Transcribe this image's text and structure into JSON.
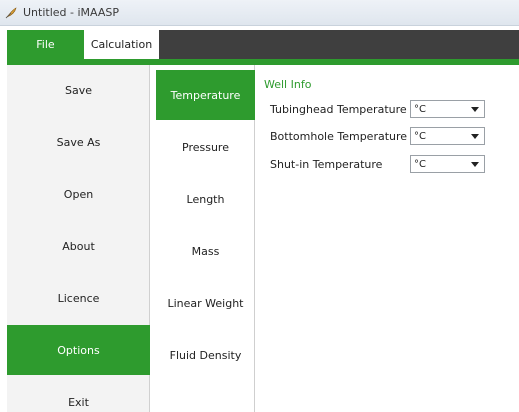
{
  "window": {
    "title": "Untitled - iMAASP",
    "app_icon": "feather-icon"
  },
  "menu": {
    "file_label": "File",
    "calculation_label": "Calculation"
  },
  "sidebar": {
    "items": [
      {
        "label": "Save"
      },
      {
        "label": "Save As"
      },
      {
        "label": "Open"
      },
      {
        "label": "About"
      },
      {
        "label": "Licence"
      },
      {
        "label": "Options",
        "active": true
      },
      {
        "label": "Exit"
      }
    ]
  },
  "subnav": {
    "items": [
      {
        "label": "Temperature",
        "active": true
      },
      {
        "label": "Pressure"
      },
      {
        "label": "Length"
      },
      {
        "label": "Mass"
      },
      {
        "label": "Linear Weight"
      },
      {
        "label": "Fluid Density"
      }
    ]
  },
  "panel": {
    "section_title": "Well Info",
    "fields": [
      {
        "label": "Tubinghead Temperature",
        "value": "°C"
      },
      {
        "label": "Bottomhole Temperature",
        "value": "°C"
      },
      {
        "label": "Shut-in Temperature",
        "value": "°C"
      }
    ]
  },
  "colors": {
    "accent": "#2e9b2e",
    "menubar": "#3f3f3f"
  }
}
